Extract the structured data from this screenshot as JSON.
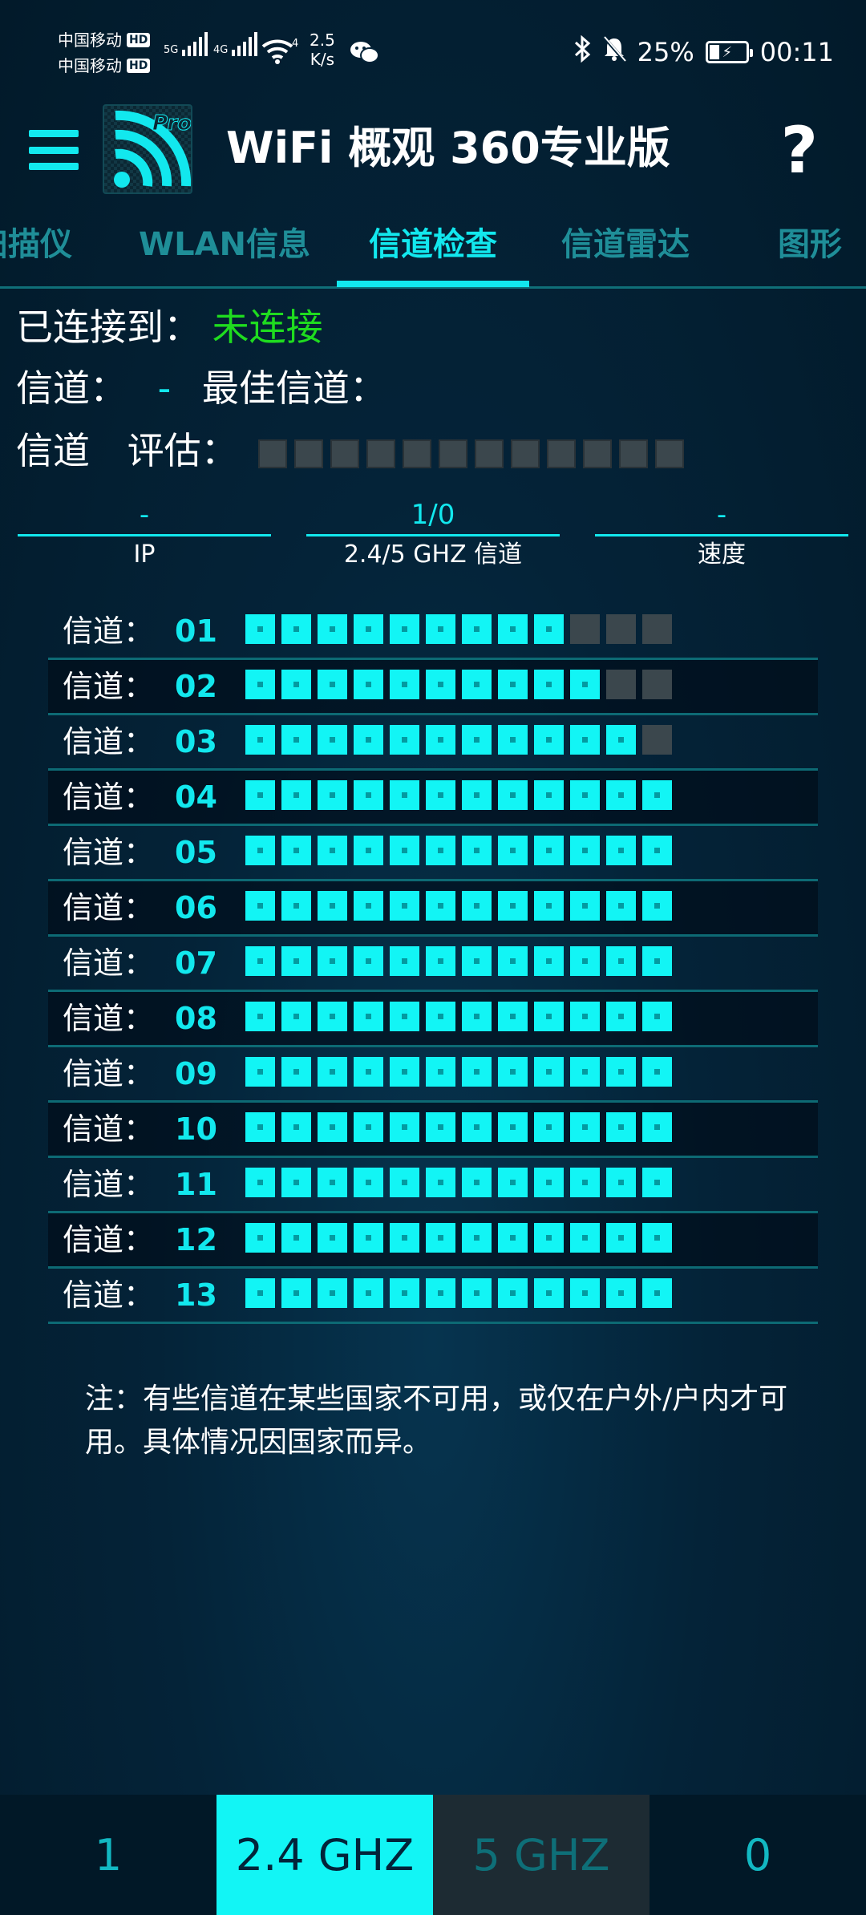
{
  "status_bar": {
    "carrier1": "中国移动",
    "carrier2": "中国移动",
    "hd": "HD",
    "sig1_label": "5G",
    "sig2_label": "4G",
    "wifi_label": "4",
    "speed_value": "2.5",
    "speed_unit": "K/s",
    "battery": "25%",
    "time": "00:11",
    "icons": [
      "wechat-icon",
      "bluetooth-icon",
      "bell-off-icon",
      "battery-icon"
    ]
  },
  "app_bar": {
    "title": "WiFi 概观 360专业版",
    "logo_badge": "Pro",
    "help": "?"
  },
  "tabs": [
    {
      "label": "扫描仪",
      "visible_label": "扫描仪"
    },
    {
      "label": "WLAN信息"
    },
    {
      "label": "信道检查",
      "active": true
    },
    {
      "label": "信道雷达"
    },
    {
      "label": "图形"
    }
  ],
  "connection": {
    "connected_label": "已连接到：",
    "connected_value": "未连接",
    "channel_label": "信道：",
    "channel_value": "-",
    "best_channel_label": "最佳信道：",
    "best_channel_value": "",
    "rating_label_1": "信道",
    "rating_label_2": "评估：",
    "rating_level": 0,
    "rating_max": 12
  },
  "stats": [
    {
      "value": "-",
      "label": "IP"
    },
    {
      "value": "1/0",
      "label": "2.4/5 GHZ 信道"
    },
    {
      "value": "-",
      "label": "速度"
    }
  ],
  "channel_label": "信道：",
  "channels": [
    {
      "num": "01",
      "level": 9,
      "max": 12
    },
    {
      "num": "02",
      "level": 10,
      "max": 12
    },
    {
      "num": "03",
      "level": 11,
      "max": 12
    },
    {
      "num": "04",
      "level": 12,
      "max": 12
    },
    {
      "num": "05",
      "level": 12,
      "max": 12
    },
    {
      "num": "06",
      "level": 12,
      "max": 12
    },
    {
      "num": "07",
      "level": 12,
      "max": 12
    },
    {
      "num": "08",
      "level": 12,
      "max": 12
    },
    {
      "num": "09",
      "level": 12,
      "max": 12
    },
    {
      "num": "10",
      "level": 12,
      "max": 12
    },
    {
      "num": "11",
      "level": 12,
      "max": 12
    },
    {
      "num": "12",
      "level": 12,
      "max": 12
    },
    {
      "num": "13",
      "level": 12,
      "max": 12
    }
  ],
  "note": "注：有些信道在某些国家不可用，或仅在户外/户内才可用。具体情况因国家而异。",
  "bottom_bar": [
    {
      "label": "1"
    },
    {
      "label": "2.4 GHZ",
      "active": true
    },
    {
      "label": "5 GHZ"
    },
    {
      "label": "0"
    }
  ],
  "colors": {
    "accent": "#12e8ee",
    "cell_on": "#12f5f5",
    "cell_off": "#3b474d",
    "connected_status": "#1fdc1f",
    "background": "#042338"
  }
}
